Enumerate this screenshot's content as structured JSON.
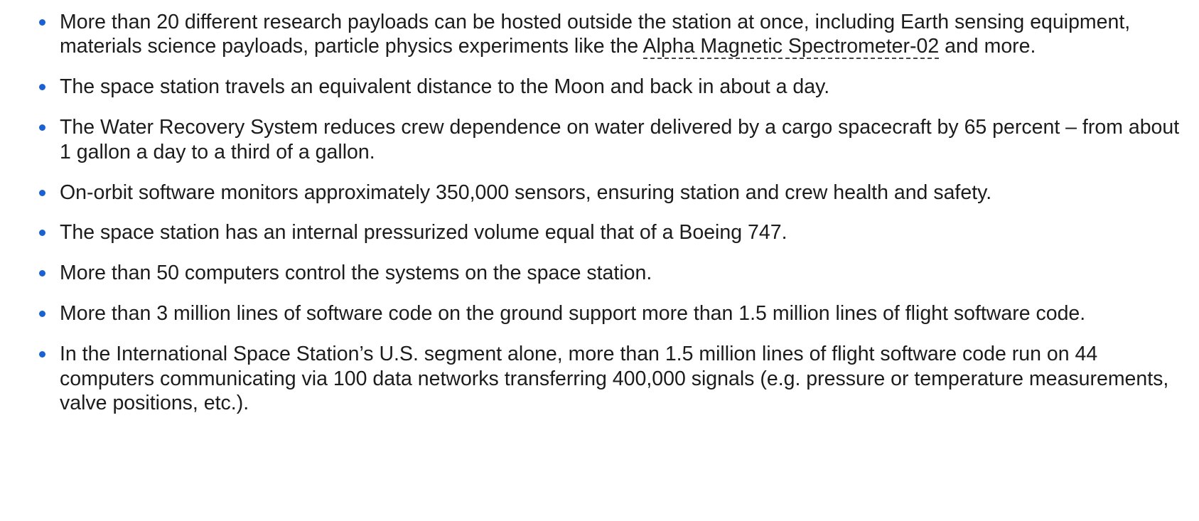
{
  "colors": {
    "bullet": "#1a62d1",
    "text": "#1c1c1c"
  },
  "facts": [
    {
      "before": "More than 20 different research payloads can be hosted outside the station at once, including Earth sensing equipment, materials science payloads, particle physics experiments like the ",
      "link": "Alpha Magnetic Spectrometer-02",
      "after": " and more."
    },
    {
      "text": "The space station travels an equivalent distance to the Moon and back in about a day."
    },
    {
      "text": "The Water Recovery System reduces crew dependence on water delivered by a cargo spacecraft by 65 percent – from about 1 gallon a day to a third of a gallon."
    },
    {
      "text": "On-orbit software monitors approximately 350,000 sensors, ensuring station and crew health and safety."
    },
    {
      "text": "The space station has an internal pressurized volume equal that of a Boeing 747."
    },
    {
      "text": "More than 50 computers control the systems on the space station."
    },
    {
      "text": "More than 3 million lines of software code on the ground support more than 1.5 million lines of flight software code."
    },
    {
      "text": "In the International Space Station’s U.S. segment alone, more than 1.5 million lines of flight software code run on 44 computers communicating via 100 data networks transferring 400,000 signals (e.g. pressure or temperature measurements, valve positions, etc.)."
    }
  ]
}
